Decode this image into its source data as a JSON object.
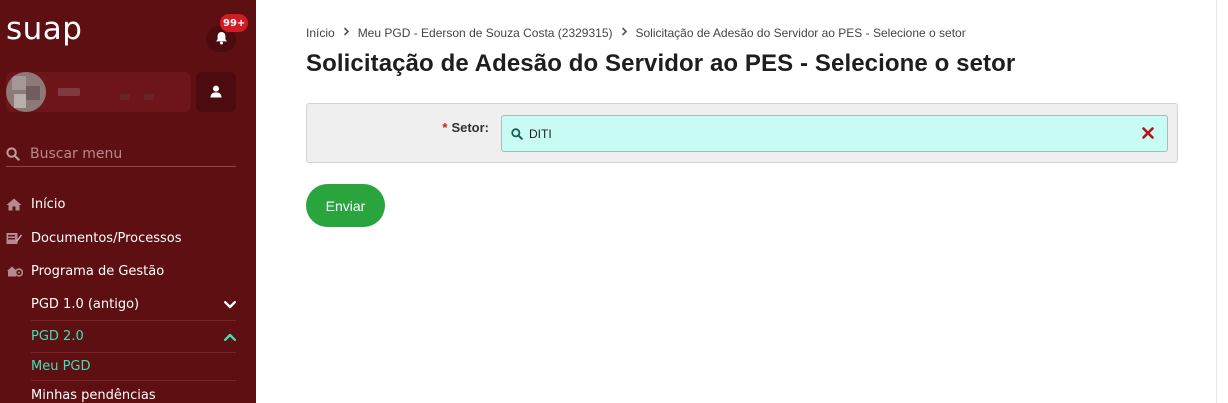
{
  "sidebar": {
    "logo": "suap",
    "notifications_badge": "99+",
    "search_placeholder": "Buscar menu",
    "items": [
      {
        "label": "Início",
        "icon": "home-icon"
      },
      {
        "label": "Documentos/Processos",
        "icon": "document-icon"
      },
      {
        "label": "Programa de Gestão",
        "icon": "management-icon"
      }
    ],
    "subitems": [
      {
        "label": "PGD 1.0 (antigo)",
        "expanded": false
      },
      {
        "label": "PGD 2.0",
        "expanded": true
      },
      {
        "label": "Meu PGD",
        "active": true
      },
      {
        "label": "Minhas pendências"
      }
    ],
    "colors": {
      "background": "#5e0f12",
      "active_text": "#3ee0b4"
    }
  },
  "breadcrumb": [
    "Início",
    "Meu PGD - Ederson de Souza Costa (2329315)",
    "Solicitação de Adesão do Servidor ao PES - Selecione o setor"
  ],
  "page_title": "Solicitação de Adesão do Servidor ao PES - Selecione o setor",
  "form": {
    "required_marker": "*",
    "setor_label": "Setor:",
    "setor_value": "DITI"
  },
  "submit_label": "Enviar",
  "colors": {
    "accent_green": "#2aa53e",
    "select_bg": "#c8fbf4",
    "required": "#c61f1f"
  }
}
